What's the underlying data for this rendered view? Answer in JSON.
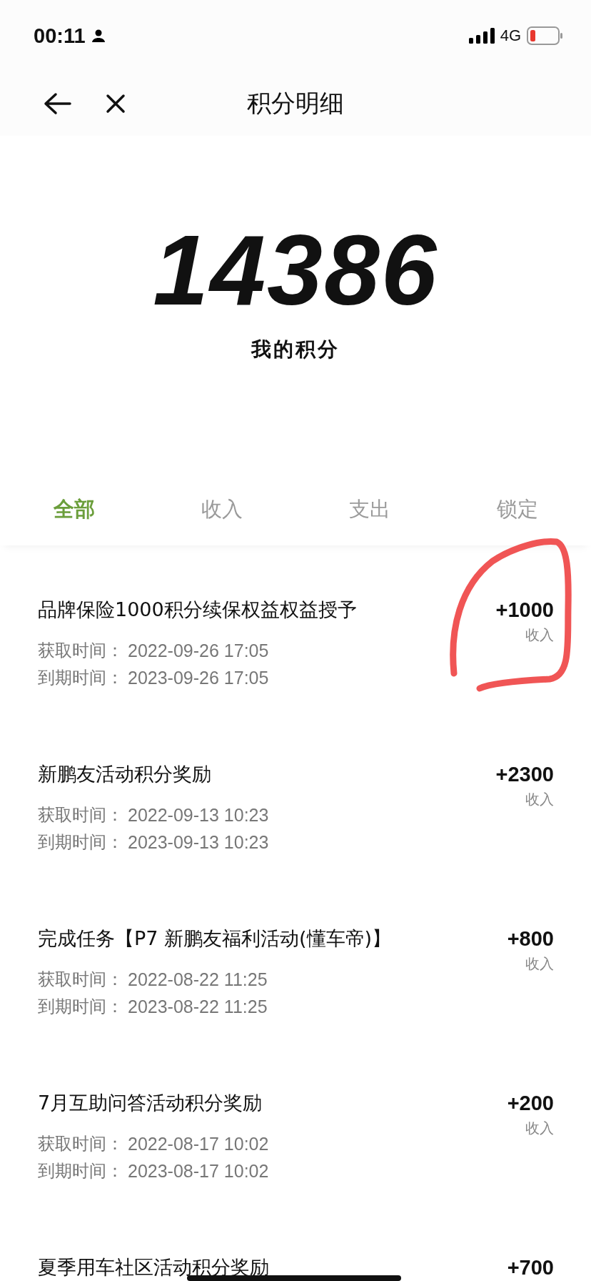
{
  "status_bar": {
    "time": "00:11",
    "network": "4G"
  },
  "nav": {
    "title": "积分明细"
  },
  "summary": {
    "points": "14386",
    "label": "我的积分"
  },
  "tabs": [
    {
      "label": "全部",
      "selected": true
    },
    {
      "label": "收入",
      "selected": false
    },
    {
      "label": "支出",
      "selected": false
    },
    {
      "label": "锁定",
      "selected": false
    }
  ],
  "records": [
    {
      "title": "品牌保险1000积分续保权益权益授予",
      "points": "+1000",
      "type": "收入",
      "dates": [
        {
          "label": "获取时间：",
          "value": "2022-09-26 17:05"
        },
        {
          "label": "到期时间：",
          "value": "2023-09-26 17:05"
        }
      ]
    },
    {
      "title": "新鹏友活动积分奖励",
      "points": "+2300",
      "type": "收入",
      "dates": [
        {
          "label": "获取时间：",
          "value": "2022-09-13 10:23"
        },
        {
          "label": "到期时间：",
          "value": "2023-09-13 10:23"
        }
      ]
    },
    {
      "title": "完成任务【P7 新鹏友福利活动(懂车帝)】",
      "points": "+800",
      "type": "收入",
      "dates": [
        {
          "label": "获取时间：",
          "value": "2022-08-22 11:25"
        },
        {
          "label": "到期时间：",
          "value": "2023-08-22 11:25"
        }
      ]
    },
    {
      "title": "7月互助问答活动积分奖励",
      "points": "+200",
      "type": "收入",
      "dates": [
        {
          "label": "获取时间：",
          "value": "2022-08-17 10:02"
        },
        {
          "label": "到期时间：",
          "value": "2023-08-17 10:02"
        }
      ]
    },
    {
      "title": "夏季用车社区活动积分奖励",
      "points": "+700"
    }
  ]
}
